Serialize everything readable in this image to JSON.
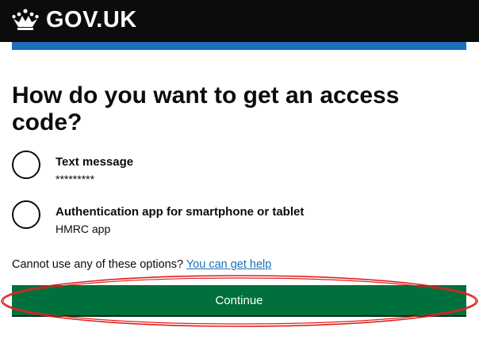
{
  "header": {
    "logo_text": "GOV.UK",
    "logo_icon": "crown-icon",
    "background": "#0b0c0c",
    "accent_bar_color": "#1d70b8"
  },
  "main": {
    "heading": "How do you want to get an access code?",
    "options": [
      {
        "label": "Text message",
        "hint": "*********",
        "selected": false
      },
      {
        "label": "Authentication app for smartphone or tablet",
        "hint": "HMRC app",
        "selected": false
      }
    ],
    "help_text": "Cannot use any of these options?",
    "help_link": "You can get help",
    "continue_label": "Continue"
  },
  "colors": {
    "link": "#1d70b8",
    "button": "#00703c",
    "annotation_ellipse": "#e0201e"
  }
}
